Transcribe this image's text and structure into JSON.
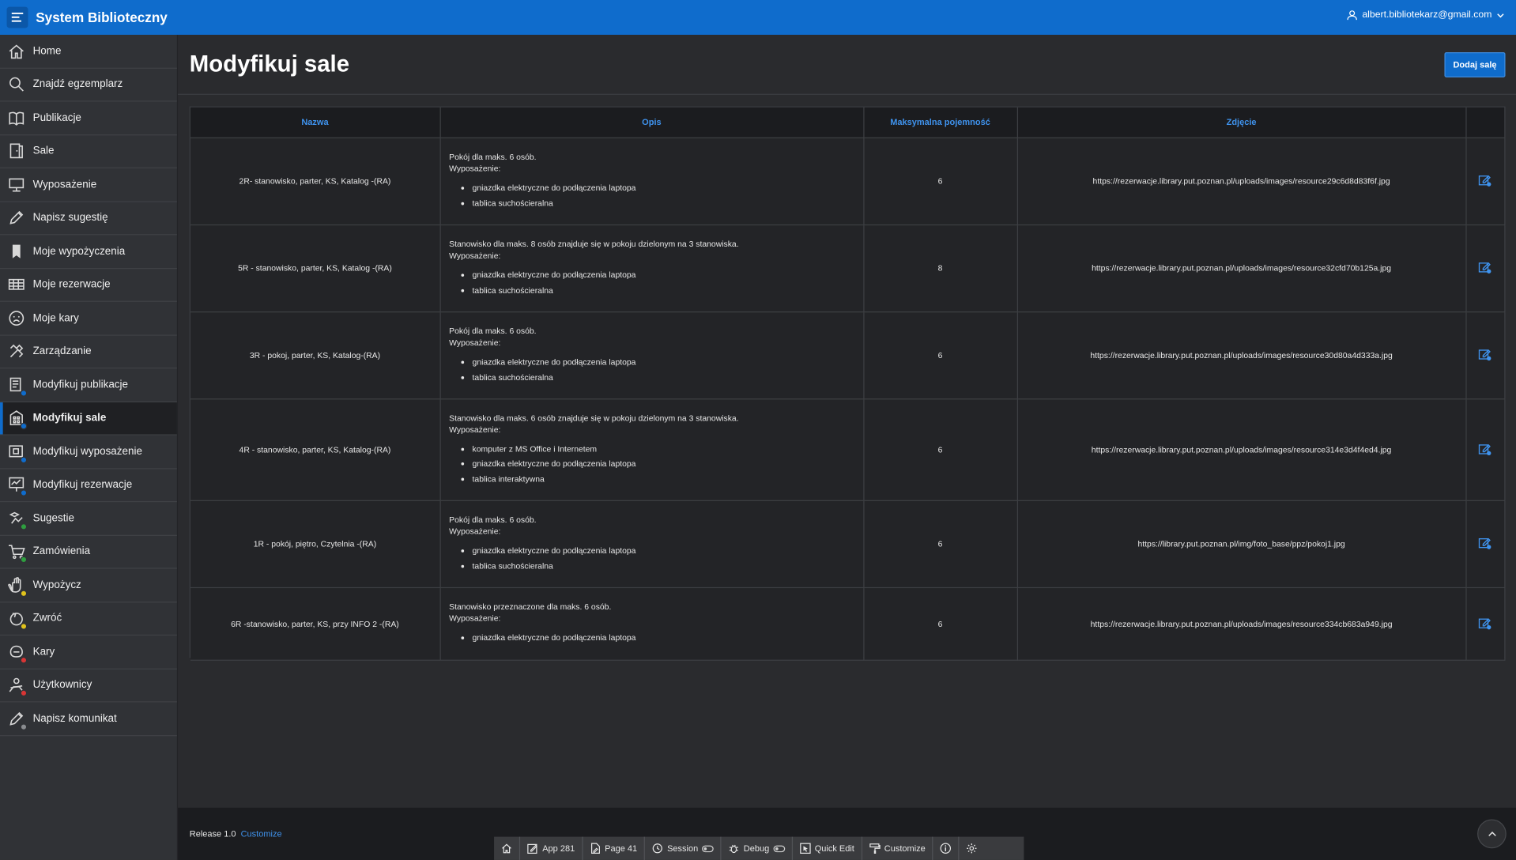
{
  "header": {
    "app_title": "System Biblioteczny",
    "user": "albert.bibliotekarz@gmail.com"
  },
  "sidebar": {
    "items": [
      {
        "label": "Home",
        "icon": "home-icon"
      },
      {
        "label": "Znajdź egzemplarz",
        "icon": "search-icon"
      },
      {
        "label": "Publikacje",
        "icon": "book-icon"
      },
      {
        "label": "Sale",
        "icon": "door-icon"
      },
      {
        "label": "Wyposażenie",
        "icon": "monitor-icon"
      },
      {
        "label": "Napisz sugestię",
        "icon": "pencil-icon"
      },
      {
        "label": "Moje wypożyczenia",
        "icon": "bookmark-icon"
      },
      {
        "label": "Moje rezerwacje",
        "icon": "table-icon"
      },
      {
        "label": "Moje kary",
        "icon": "face-icon"
      },
      {
        "label": "Zarządzanie",
        "icon": "tools-icon"
      },
      {
        "label": "Modyfikuj publikacje",
        "icon": "publication-edit-icon"
      },
      {
        "label": "Modyfikuj sale",
        "icon": "building-edit-icon"
      },
      {
        "label": "Modyfikuj wyposażenie",
        "icon": "equipment-edit-icon"
      },
      {
        "label": "Modyfikuj rezerwacje",
        "icon": "presentation-edit-icon"
      },
      {
        "label": "Sugestie",
        "icon": "suggestion-icon"
      },
      {
        "label": "Zamówienia",
        "icon": "cart-icon"
      },
      {
        "label": "Wypożycz",
        "icon": "hand-icon"
      },
      {
        "label": "Zwróć",
        "icon": "return-icon"
      },
      {
        "label": "Kary",
        "icon": "penalty-icon"
      },
      {
        "label": "Użytkownicy",
        "icon": "users-icon"
      },
      {
        "label": "Napisz komunikat",
        "icon": "message-icon"
      }
    ],
    "active_index": 11
  },
  "main": {
    "title": "Modyfikuj sale",
    "add_button": "Dodaj salę"
  },
  "table": {
    "headers": [
      "Nazwa",
      "Opis",
      "Maksymalna pojemność",
      "Zdjęcie"
    ],
    "rows": [
      {
        "nazwa": "2R- stanowisko, parter, KS, Katalog -(RA)",
        "opis_line1": "Pokój dla maks. 6 osób.",
        "opis_line2": "Wyposażenie:",
        "items": [
          "gniazdka elektryczne do podłączenia laptopa",
          "tablica suchościeralna"
        ],
        "pojemnosc": "6",
        "zdjecie": "https://rezerwacje.library.put.poznan.pl/uploads/images/resource29c6d8d83f6f.jpg"
      },
      {
        "nazwa": "5R - stanowisko, parter, KS, Katalog -(RA)",
        "opis_line1": "Stanowisko dla maks. 8 osób znajduje się w pokoju dzielonym na 3 stanowiska.",
        "opis_line2": "Wyposażenie:",
        "items": [
          "gniazdka elektryczne do podłączenia laptopa",
          "tablica suchościeralna"
        ],
        "pojemnosc": "8",
        "zdjecie": "https://rezerwacje.library.put.poznan.pl/uploads/images/resource32cfd70b125a.jpg"
      },
      {
        "nazwa": "3R - pokoj, parter, KS, Katalog-(RA)",
        "opis_line1": "Pokój dla maks. 6 osób.",
        "opis_line2": "Wyposażenie:",
        "items": [
          "gniazdka elektryczne do podłączenia laptopa",
          "tablica suchościeralna"
        ],
        "pojemnosc": "6",
        "zdjecie": "https://rezerwacje.library.put.poznan.pl/uploads/images/resource30d80a4d333a.jpg"
      },
      {
        "nazwa": "4R - stanowisko, parter, KS, Katalog-(RA)",
        "opis_line1": "Stanowisko dla maks. 6 osób znajduje się w pokoju dzielonym na 3 stanowiska.",
        "opis_line2": "Wyposażenie:",
        "items": [
          "komputer z MS Office i Internetem",
          "gniazdka elektryczne do podłączenia laptopa",
          "tablica interaktywna"
        ],
        "pojemnosc": "6",
        "zdjecie": "https://rezerwacje.library.put.poznan.pl/uploads/images/resource314e3d4f4ed4.jpg"
      },
      {
        "nazwa": "1R - pokój, piętro, Czytelnia -(RA)",
        "opis_line1": "Pokój dla maks. 6 osób.",
        "opis_line2": "Wyposażenie:",
        "items": [
          "gniazdka elektryczne do podłączenia laptopa",
          "tablica suchościeralna"
        ],
        "pojemnosc": "6",
        "zdjecie": "https://library.put.poznan.pl/img/foto_base/ppz/pokoj1.jpg"
      },
      {
        "nazwa": "6R -stanowisko, parter, KS, przy INFO 2 -(RA)",
        "opis_line1": "Stanowisko przeznaczone dla maks. 6 osób.",
        "opis_line2": "Wyposażenie:",
        "items": [
          "gniazdka elektryczne do podłączenia laptopa"
        ],
        "pojemnosc": "6",
        "zdjecie": "https://rezerwacje.library.put.poznan.pl/uploads/images/resource334cb683a949.jpg"
      }
    ]
  },
  "footer": {
    "release": "Release 1.0",
    "customize": "Customize"
  },
  "devbar": {
    "app": "App 281",
    "page": "Page 41",
    "session": "Session",
    "debug": "Debug",
    "quick_edit": "Quick Edit",
    "customize": "Customize"
  },
  "colors": {
    "accent": "#0f6ccc",
    "link": "#3f93ee",
    "sidebar_bg": "#303236",
    "content_bg": "#2a2b2e"
  }
}
